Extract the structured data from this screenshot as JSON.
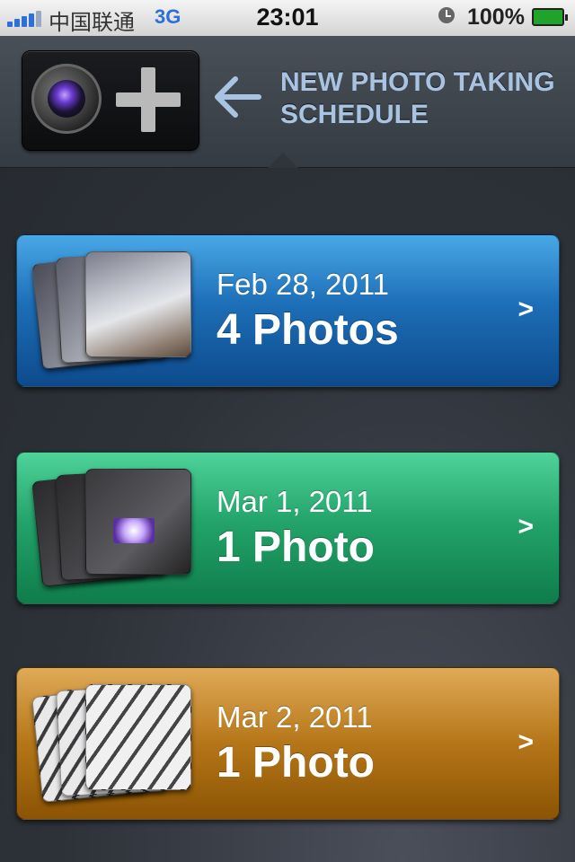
{
  "status_bar": {
    "carrier": "中国联通",
    "network": "3G",
    "time": "23:01",
    "battery_percent": "100%"
  },
  "header": {
    "title_line1": "NEW PHOTO TAKING",
    "title_line2": "SCHEDULE",
    "add_icon": "camera-plus-icon",
    "arrow_icon": "arrow-left-icon"
  },
  "schedules": [
    {
      "date": "Feb 28, 2011",
      "count": "4 Photos",
      "color": "#1d6fb8",
      "chevron": ">"
    },
    {
      "date": "Mar 1, 2011",
      "count": "1 Photo",
      "color": "#23a46a",
      "chevron": ">"
    },
    {
      "date": "Mar 2, 2011",
      "count": "1 Photo",
      "color": "#b57618",
      "chevron": ">"
    }
  ]
}
